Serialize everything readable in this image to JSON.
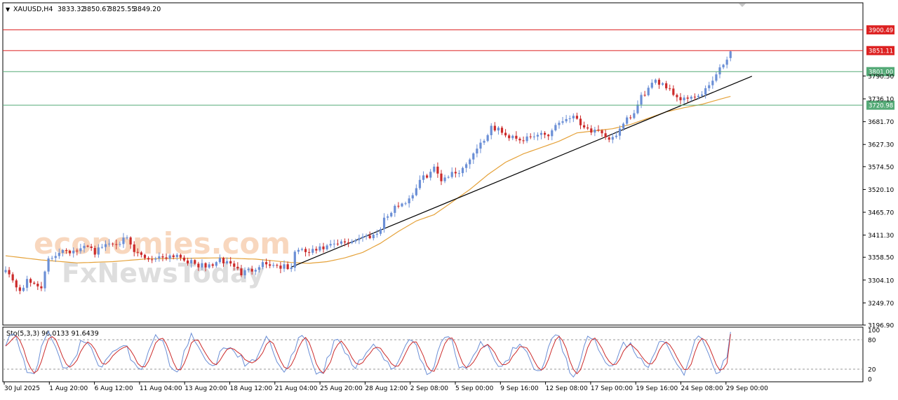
{
  "header": {
    "symbol": "XAUUSD,H4",
    "open": "3833.32",
    "high": "3850.67",
    "low": "3825.55",
    "close": "3849.20"
  },
  "watermark": {
    "brand": "economies.com",
    "sub": "FxNewsToday"
  },
  "chart_data": {
    "type": "candlestick",
    "symbol": "XAUUSD",
    "timeframe": "H4",
    "ohlc_last": {
      "open": 3833.32,
      "high": 3850.67,
      "low": 3825.55,
      "close": 3849.2
    },
    "price_axis_ticks": [
      "3790.50",
      "3736.10",
      "3681.70",
      "3627.30",
      "3574.50",
      "3520.10",
      "3465.70",
      "3411.30",
      "3358.50",
      "3304.10",
      "3249.70",
      "3196.90"
    ],
    "price_range": [
      3196.9,
      3965
    ],
    "time_labels": [
      "30 Jul 2025",
      "1 Aug 20:00",
      "6 Aug 12:00",
      "11 Aug 04:00",
      "13 Aug 20:00",
      "18 Aug 12:00",
      "21 Aug 04:00",
      "25 Aug 20:00",
      "28 Aug 12:00",
      "2 Sep 08:00",
      "5 Sep 00:00",
      "9 Sep 16:00",
      "12 Sep 08:00",
      "17 Sep 00:00",
      "19 Sep 16:00",
      "24 Sep 08:00",
      "29 Sep 00:00"
    ],
    "close_path": [
      [
        0,
        3335
      ],
      [
        2,
        3300
      ],
      [
        4,
        3280
      ],
      [
        6,
        3300
      ],
      [
        10,
        3290
      ],
      [
        12,
        3350
      ],
      [
        14,
        3365
      ],
      [
        16,
        3380
      ],
      [
        19,
        3370
      ],
      [
        21,
        3375
      ],
      [
        23,
        3390
      ],
      [
        25,
        3370
      ],
      [
        28,
        3390
      ],
      [
        31,
        3395
      ],
      [
        34,
        3400
      ],
      [
        36,
        3370
      ],
      [
        40,
        3355
      ],
      [
        44,
        3360
      ],
      [
        48,
        3365
      ],
      [
        52,
        3345
      ],
      [
        56,
        3335
      ],
      [
        60,
        3350
      ],
      [
        63,
        3345
      ],
      [
        66,
        3320
      ],
      [
        69,
        3330
      ],
      [
        72,
        3345
      ],
      [
        75,
        3340
      ],
      [
        78,
        3335
      ],
      [
        80,
        3330
      ],
      [
        81,
        3375
      ],
      [
        85,
        3370
      ],
      [
        89,
        3380
      ],
      [
        93,
        3390
      ],
      [
        96,
        3395
      ],
      [
        99,
        3405
      ],
      [
        102,
        3410
      ],
      [
        104,
        3415
      ],
      [
        106,
        3450
      ],
      [
        108,
        3465
      ],
      [
        110,
        3485
      ],
      [
        112,
        3490
      ],
      [
        114,
        3510
      ],
      [
        116,
        3540
      ],
      [
        118,
        3555
      ],
      [
        120,
        3570
      ],
      [
        122,
        3545
      ],
      [
        124,
        3555
      ],
      [
        126,
        3560
      ],
      [
        128,
        3570
      ],
      [
        130,
        3595
      ],
      [
        132,
        3620
      ],
      [
        134,
        3640
      ],
      [
        136,
        3665
      ],
      [
        138,
        3665
      ],
      [
        140,
        3645
      ],
      [
        142,
        3650
      ],
      [
        144,
        3640
      ],
      [
        146,
        3640
      ],
      [
        148,
        3645
      ],
      [
        150,
        3655
      ],
      [
        152,
        3650
      ],
      [
        154,
        3675
      ],
      [
        156,
        3685
      ],
      [
        158,
        3695
      ],
      [
        160,
        3690
      ],
      [
        162,
        3670
      ],
      [
        164,
        3660
      ],
      [
        166,
        3655
      ],
      [
        168,
        3640
      ],
      [
        170,
        3645
      ],
      [
        172,
        3660
      ],
      [
        174,
        3685
      ],
      [
        176,
        3700
      ],
      [
        178,
        3740
      ],
      [
        180,
        3760
      ],
      [
        182,
        3775
      ],
      [
        184,
        3775
      ],
      [
        186,
        3760
      ],
      [
        188,
        3740
      ],
      [
        190,
        3735
      ],
      [
        192,
        3745
      ],
      [
        194,
        3740
      ],
      [
        196,
        3755
      ],
      [
        198,
        3780
      ],
      [
        200,
        3805
      ],
      [
        202,
        3830
      ],
      [
        203,
        3849.2
      ]
    ],
    "ma_path": [
      [
        0,
        3362
      ],
      [
        10,
        3352
      ],
      [
        20,
        3345
      ],
      [
        30,
        3348
      ],
      [
        40,
        3355
      ],
      [
        50,
        3356
      ],
      [
        60,
        3357
      ],
      [
        70,
        3354
      ],
      [
        80,
        3346
      ],
      [
        85,
        3344
      ],
      [
        90,
        3348
      ],
      [
        95,
        3357
      ],
      [
        100,
        3370
      ],
      [
        105,
        3392
      ],
      [
        110,
        3420
      ],
      [
        115,
        3445
      ],
      [
        120,
        3460
      ],
      [
        125,
        3490
      ],
      [
        130,
        3520
      ],
      [
        135,
        3555
      ],
      [
        140,
        3585
      ],
      [
        145,
        3605
      ],
      [
        150,
        3620
      ],
      [
        155,
        3635
      ],
      [
        160,
        3655
      ],
      [
        165,
        3660
      ],
      [
        170,
        3665
      ],
      [
        175,
        3675
      ],
      [
        180,
        3690
      ],
      [
        185,
        3705
      ],
      [
        190,
        3715
      ],
      [
        195,
        3723
      ],
      [
        200,
        3735
      ],
      [
        203,
        3742
      ]
    ],
    "trendline": {
      "from": [
        80,
        3335
      ],
      "to": [
        209,
        3790
      ]
    },
    "levels": [
      {
        "price": 3900.49,
        "label": "3900.49",
        "color": "#dd2222",
        "kind": "resistance"
      },
      {
        "price": 3851.11,
        "label": "3851.11",
        "color": "#dd2222",
        "kind": "resistance"
      },
      {
        "price": 3801.0,
        "label": "3801.00",
        "color": "#55aa77",
        "kind": "support"
      },
      {
        "price": 3720.98,
        "label": "3720.98",
        "color": "#55aa77",
        "kind": "support"
      }
    ],
    "stochastic": {
      "label": "Sto(5,3,3) 96.0133 91.6439",
      "k": 96.0133,
      "d": 91.6439,
      "range": [
        0,
        100
      ],
      "levels": [
        20,
        80
      ],
      "ticks": [
        "100",
        "80",
        "20",
        "0"
      ]
    },
    "colors": {
      "up": "#6b8fd6",
      "down": "#cc2b2b",
      "ma": "#e5a23a",
      "stoch_k": "#6b8fd6",
      "stoch_d": "#cc2b2b"
    }
  }
}
